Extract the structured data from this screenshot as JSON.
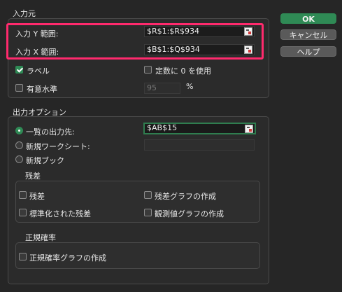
{
  "input_section": {
    "title": "入力元",
    "y_range": {
      "label": "入力 Y 範囲:",
      "value": "$R$1:$R$934"
    },
    "x_range": {
      "label": "入力 X 範囲:",
      "value": "$B$1:$Q$934"
    },
    "labels_checkbox": {
      "label": "ラベル",
      "checked": true
    },
    "constant_zero_checkbox": {
      "label": "定数に 0 を使用",
      "checked": false
    },
    "confidence_checkbox": {
      "label": "有意水準",
      "checked": false
    },
    "confidence_value": "95",
    "confidence_unit": "%"
  },
  "buttons": {
    "ok": "OK",
    "cancel": "キャンセル",
    "help": "ヘルプ"
  },
  "output_section": {
    "title": "出力オプション",
    "output_range": {
      "label": "一覧の出力先:",
      "value": "$AB$15",
      "selected": true
    },
    "new_worksheet": {
      "label": "新規ワークシート:",
      "value": "",
      "selected": false
    },
    "new_workbook": {
      "label": "新規ブック",
      "selected": false
    }
  },
  "residuals_section": {
    "title": "残差",
    "residuals": {
      "label": "残差",
      "checked": false
    },
    "residual_plots": {
      "label": "残差グラフの作成",
      "checked": false
    },
    "standardized_residuals": {
      "label": "標準化された残差",
      "checked": false
    },
    "line_fit_plots": {
      "label": "観測値グラフの作成",
      "checked": false
    }
  },
  "normal_section": {
    "title": "正規確率",
    "normal_plots": {
      "label": "正規確率グラフの作成",
      "checked": false
    }
  },
  "colors": {
    "accent": "#2f8a55",
    "highlight": "#ff2a6d",
    "background": "#262626"
  }
}
